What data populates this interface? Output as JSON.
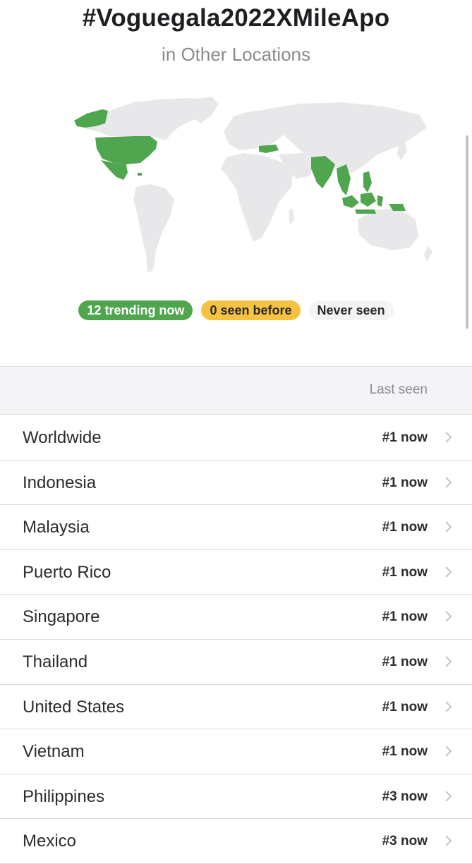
{
  "header": {
    "title": "#Voguegala2022XMileApo",
    "subtitle": "in Other Locations"
  },
  "map": {
    "highlight_color": "#4fa64f",
    "land_color": "#e8e8ea"
  },
  "legend": {
    "trending": "12 trending now",
    "seen_before": "0 seen before",
    "never_seen": "Never seen"
  },
  "table": {
    "column_header": "Last seen",
    "rows": [
      {
        "location": "Worldwide",
        "rank": "#1 now"
      },
      {
        "location": "Indonesia",
        "rank": "#1 now"
      },
      {
        "location": "Malaysia",
        "rank": "#1 now"
      },
      {
        "location": "Puerto Rico",
        "rank": "#1 now"
      },
      {
        "location": "Singapore",
        "rank": "#1 now"
      },
      {
        "location": "Thailand",
        "rank": "#1 now"
      },
      {
        "location": "United States",
        "rank": "#1 now"
      },
      {
        "location": "Vietnam",
        "rank": "#1 now"
      },
      {
        "location": "Philippines",
        "rank": "#3 now"
      },
      {
        "location": "Mexico",
        "rank": "#3 now"
      }
    ]
  }
}
